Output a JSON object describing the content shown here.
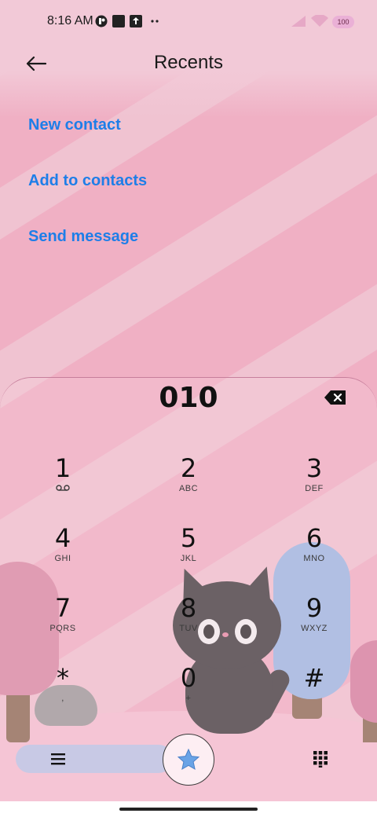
{
  "status_bar": {
    "time": "8:16 AM",
    "battery": "100",
    "icons": [
      "app-notification-icon",
      "square-notification-icon",
      "upload-notification-icon",
      "more-dots-icon",
      "signal-icon",
      "wifi-icon",
      "battery-icon"
    ]
  },
  "header": {
    "title": "Recents",
    "back_icon": "back-arrow-icon"
  },
  "actions": {
    "new_contact": "New contact",
    "add_to_contacts": "Add to contacts",
    "send_message": "Send message"
  },
  "dialer": {
    "number": "010",
    "keys": [
      {
        "digit": "1",
        "sub": ""
      },
      {
        "digit": "2",
        "sub": "ABC"
      },
      {
        "digit": "3",
        "sub": "DEF"
      },
      {
        "digit": "4",
        "sub": "GHI"
      },
      {
        "digit": "5",
        "sub": "JKL"
      },
      {
        "digit": "6",
        "sub": "MNO"
      },
      {
        "digit": "7",
        "sub": "PQRS"
      },
      {
        "digit": "8",
        "sub": "TUV"
      },
      {
        "digit": "9",
        "sub": "WXYZ"
      },
      {
        "digit": "*",
        "sub": ","
      },
      {
        "digit": "0",
        "sub": "+"
      },
      {
        "digit": "#",
        "sub": ""
      }
    ]
  },
  "bottom_bar": {
    "menu_icon": "menu-icon",
    "call_icon": "star-call-icon",
    "keypad_icon": "keypad-icon"
  },
  "colors": {
    "link": "#1e7ee8",
    "background": "#f0c3d1",
    "sheet_border": "#c77f9c"
  }
}
